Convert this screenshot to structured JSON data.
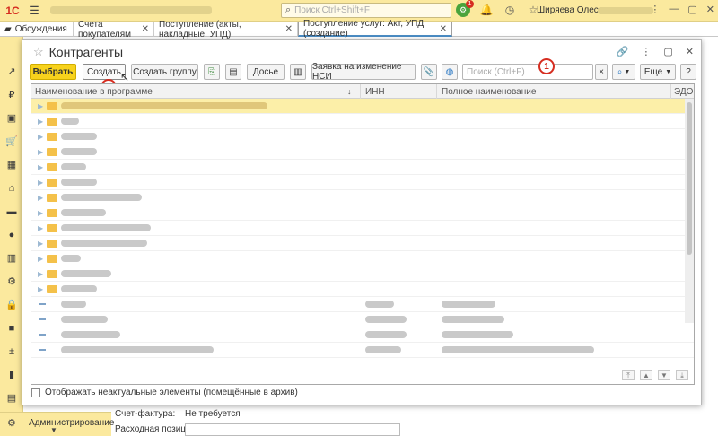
{
  "app": {
    "logo": "1C",
    "search_placeholder": "Поиск Ctrl+Shift+F",
    "notification_count": "1",
    "user_name": "Ширяева Олеся"
  },
  "tabs": [
    {
      "label": "Обсуждения"
    },
    {
      "label": "Счета покупателям"
    },
    {
      "label": "Поступление (акты, накладные, УПД)"
    },
    {
      "label": "Поступление услуг: Акт, УПД (создание)"
    }
  ],
  "sidebar": {
    "admin_label": "Администрирование"
  },
  "background_form": {
    "invoice_label": "Счет-фактура:",
    "invoice_value": "Не требуется",
    "expense_label": "Расходная позиция"
  },
  "modal": {
    "title": "Контрагенты",
    "toolbar": {
      "select": "Выбрать",
      "create": "Создать",
      "create_group": "Создать группу",
      "dossier": "Досье",
      "nsi_request": "Заявка на изменение НСИ",
      "search_placeholder": "Поиск (Ctrl+F)",
      "more": "Еще",
      "help": "?"
    },
    "markers": [
      "1",
      "2"
    ],
    "columns": {
      "name": "Наименование в программе",
      "inn": "ИНН",
      "full_name": "Полное наименование",
      "edo": "ЭДО"
    },
    "archive_checkbox": "Отображать неактуальные элементы (помещённые в архив)"
  }
}
